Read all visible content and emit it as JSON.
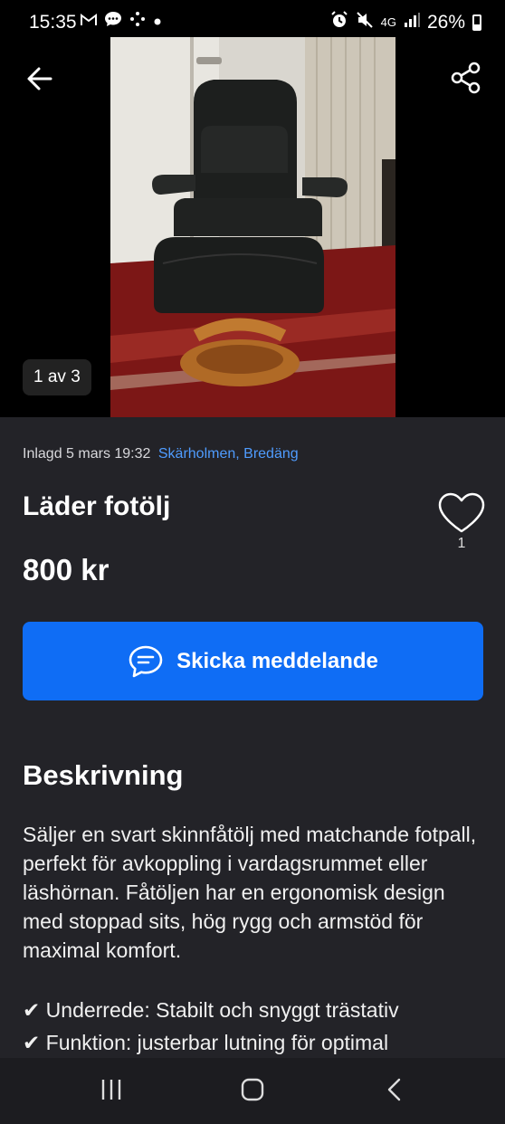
{
  "status_bar": {
    "time": "15:35",
    "left_icons": [
      "gmail-icon",
      "chat-bubble-icon",
      "dots-icon",
      "dot-icon"
    ],
    "battery_percent": "26%",
    "network": "4G"
  },
  "gallery": {
    "counter": "1 av 3"
  },
  "listing": {
    "posted": "Inlagd 5 mars 19:32",
    "location": "Skärholmen, Bredäng",
    "title": "Läder fotölj",
    "favorites_count": "1",
    "price": "800 kr",
    "message_button": "Skicka meddelande",
    "description_heading": "Beskrivning",
    "description": "Säljer en svart skinnfåtölj med matchande fotpall, perfekt för avkoppling i vardagsrummet eller läshörnan. Fåtöljen har en ergonomisk design med stoppad sits, hög rygg och armstöd för maximal komfort.",
    "bullets": [
      "✔ Underrede: Stabilt och snyggt trästativ",
      "✔ Funktion: justerbar lutning för optimal"
    ]
  },
  "colors": {
    "accent": "#0f6df5",
    "link": "#4f9cff",
    "background": "#232328"
  }
}
